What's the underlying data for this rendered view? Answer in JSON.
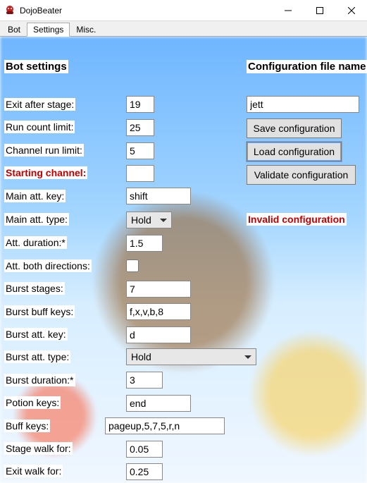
{
  "window": {
    "title": "DojoBeater"
  },
  "tabs": {
    "bot": "Bot",
    "settings": "Settings",
    "misc": "Misc."
  },
  "headings": {
    "bot_settings": "Bot settings",
    "config_file_name": "Configuration file name"
  },
  "labels": {
    "exit_after_stage": "Exit after stage:",
    "run_count_limit": "Run count limit:",
    "channel_run_limit": "Channel run limit:",
    "starting_channel": "Starting channel:",
    "main_att_key": "Main att. key:",
    "main_att_type": "Main att. type:",
    "att_duration": "Att. duration:*",
    "att_both_directions": "Att. both directions:",
    "burst_stages": "Burst stages:",
    "burst_buff_keys": "Burst buff keys:",
    "burst_att_key": "Burst att. key:",
    "burst_att_type": "Burst att. type:",
    "burst_duration": "Burst duration:*",
    "potion_keys": "Potion keys:",
    "buff_keys": "Buff keys:",
    "stage_walk_for": "Stage walk for:",
    "exit_walk_for": "Exit walk for:"
  },
  "fields": {
    "exit_after_stage": "19",
    "run_count_limit": "25",
    "channel_run_limit": "5",
    "starting_channel": "",
    "main_att_key": "shift",
    "main_att_type": "Hold",
    "att_duration": "1.5",
    "att_both_directions": false,
    "burst_stages": "7",
    "burst_buff_keys": "f,x,v,b,8",
    "burst_att_key": "d",
    "burst_att_type": "Hold",
    "burst_duration": "3",
    "potion_keys": "end",
    "buff_keys": "pageup,5,7,5,r,n",
    "stage_walk_for": "0.05",
    "exit_walk_for": "0.25",
    "config_name": "jett"
  },
  "buttons": {
    "save": "Save configuration",
    "load": "Load configuration",
    "validate": "Validate configuration"
  },
  "status_message": "Invalid configuration",
  "colors": {
    "error": "#c00000"
  }
}
